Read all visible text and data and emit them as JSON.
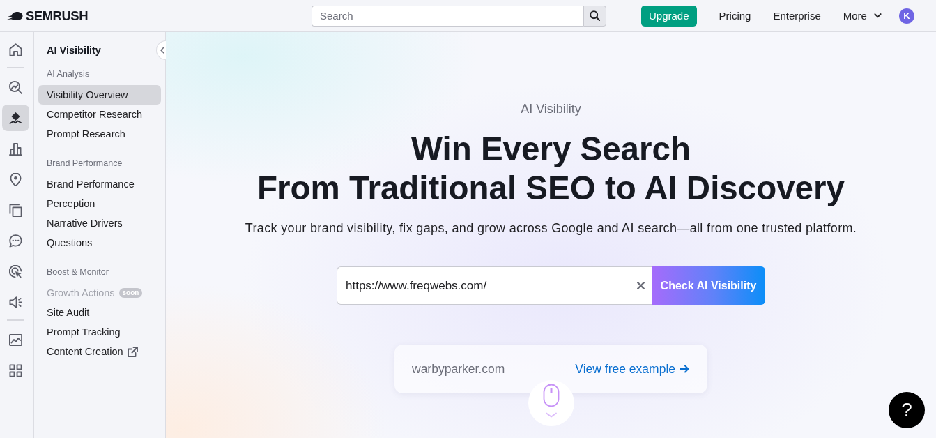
{
  "header": {
    "logo": "SEMRUSH",
    "search": {
      "placeholder": "Search"
    },
    "upgrade": "Upgrade",
    "nav": [
      {
        "label": "Pricing",
        "dropdown": false
      },
      {
        "label": "Enterprise",
        "dropdown": false
      },
      {
        "label": "More",
        "dropdown": true
      }
    ],
    "avatar": "K"
  },
  "rail": {
    "groups": [
      [
        {
          "selected": false
        }
      ],
      [
        {
          "selected": false
        },
        {
          "selected": true
        },
        {
          "selected": false
        },
        {
          "selected": false
        },
        {
          "selected": false
        },
        {
          "selected": false
        },
        {
          "selected": false
        },
        {
          "selected": false
        }
      ],
      [
        {
          "selected": false
        },
        {
          "selected": false
        }
      ]
    ]
  },
  "sidebar": {
    "title": "AI Visibility",
    "sections": [
      {
        "heading": "AI Analysis",
        "items": [
          {
            "label": "Visibility Overview",
            "selected": true,
            "disabled": false,
            "external": false
          },
          {
            "label": "Competitor Research",
            "selected": false,
            "disabled": false,
            "external": false
          },
          {
            "label": "Prompt Research",
            "selected": false,
            "disabled": false,
            "external": false
          }
        ]
      },
      {
        "heading": "Brand Performance",
        "items": [
          {
            "label": "Brand Performance",
            "selected": false,
            "disabled": false,
            "external": false
          },
          {
            "label": "Perception",
            "selected": false,
            "disabled": false,
            "external": false
          },
          {
            "label": "Narrative Drivers",
            "selected": false,
            "disabled": false,
            "external": false
          },
          {
            "label": "Questions",
            "selected": false,
            "disabled": false,
            "external": false
          }
        ]
      },
      {
        "heading": "Boost & Monitor",
        "items": [
          {
            "label": "Growth Actions",
            "badge": "soon",
            "selected": false,
            "disabled": true,
            "external": false
          },
          {
            "label": "Site Audit",
            "selected": false,
            "disabled": false,
            "external": false
          },
          {
            "label": "Prompt Tracking",
            "selected": false,
            "disabled": false,
            "external": false
          },
          {
            "label": "Content Creation",
            "selected": false,
            "disabled": false,
            "external": true
          }
        ]
      }
    ]
  },
  "hero": {
    "eyebrow": "AI Visibility",
    "heading": [
      "Win Every Search",
      "From Traditional SEO to AI Discovery"
    ],
    "subtitle": "Track your brand visibility, fix gaps, and grow across Google and AI search—all from one trusted platform.",
    "url_field": {
      "value": "https://www.freqwebs.com/"
    },
    "submit": "Check AI Visibility",
    "example": {
      "domain": "warbyparker.com",
      "link": "View free example"
    }
  },
  "help_button": "?"
}
